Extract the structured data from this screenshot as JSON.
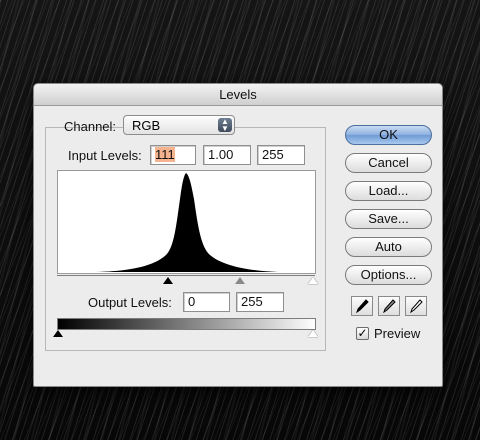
{
  "dialog": {
    "title": "Levels",
    "channel_label": "Channel:",
    "channel_value": "RGB",
    "input_levels_label": "Input Levels:",
    "input_levels": [
      "111",
      "1.00",
      "255"
    ],
    "output_levels_label": "Output Levels:",
    "output_levels": [
      "0",
      "255"
    ],
    "buttons": [
      "OK",
      "Cancel",
      "Load...",
      "Save...",
      "Auto",
      "Options..."
    ],
    "preview_label": "Preview",
    "preview_checked": true
  },
  "icons": {
    "pickers": [
      "black-eyedropper-icon",
      "gray-eyedropper-icon",
      "white-eyedropper-icon"
    ],
    "checkmark": "✓"
  },
  "colors": {
    "default_button": "#7ea6dc",
    "highlight": "#f5b48f"
  }
}
